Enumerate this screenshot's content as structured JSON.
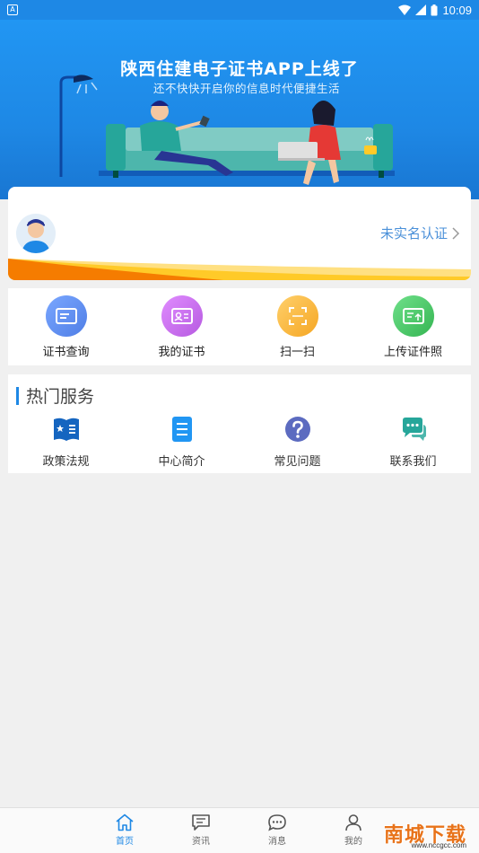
{
  "status_bar": {
    "time": "10:09"
  },
  "banner": {
    "title": "陕西住建电子证书APP上线了",
    "subtitle": "还不快快开启你的信息时代便捷生活"
  },
  "profile": {
    "verify_label": "未实名认证"
  },
  "quick_actions": [
    {
      "label": "证书查询",
      "icon": "certificate-search-icon",
      "color": "#5b8def"
    },
    {
      "label": "我的证书",
      "icon": "id-card-icon",
      "color": "#c268e8"
    },
    {
      "label": "扫一扫",
      "icon": "scan-icon",
      "color": "#f7b23b"
    },
    {
      "label": "上传证件照",
      "icon": "upload-icon",
      "color": "#43c25f"
    }
  ],
  "hot_services": {
    "title": "热门服务",
    "items": [
      {
        "label": "政策法规",
        "icon": "book-icon",
        "color": "#1565c0"
      },
      {
        "label": "中心简介",
        "icon": "document-icon",
        "color": "#2196f3"
      },
      {
        "label": "常见问题",
        "icon": "question-icon",
        "color": "#5c6bc0"
      },
      {
        "label": "联系我们",
        "icon": "chat-icon",
        "color": "#26a69a"
      }
    ]
  },
  "bottom_nav": [
    {
      "label": "首页",
      "icon": "home-icon",
      "active": true
    },
    {
      "label": "资讯",
      "icon": "news-icon",
      "active": false
    },
    {
      "label": "消息",
      "icon": "message-icon",
      "active": false
    },
    {
      "label": "我的",
      "icon": "user-icon",
      "active": false
    }
  ],
  "watermark": {
    "main": "南城下载",
    "url": "www.nccgcc.com"
  }
}
